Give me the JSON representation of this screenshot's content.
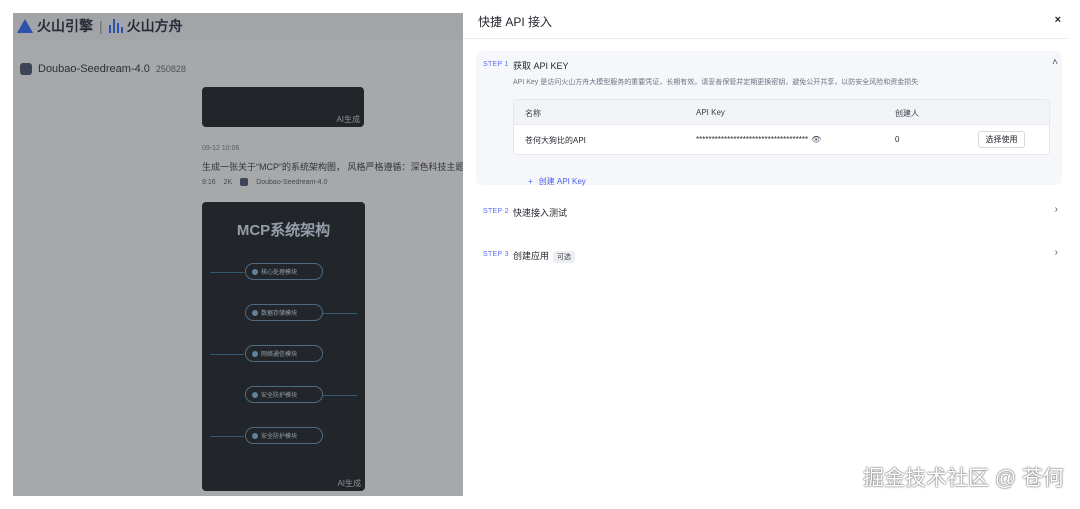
{
  "background": {
    "logo": {
      "brand1": "火山引擎",
      "separator": "|",
      "brand2": "火山方舟"
    },
    "model": {
      "name": "Doubao-Seedream-4.0",
      "version": "250828"
    },
    "top_image_tag": "AI生成",
    "history_time": "09-12 10:06",
    "prompt": "生成一张关于“MCP”的系统架构图， 风格严格遵循：深色科技主题",
    "chips": {
      "ratio": "9:16",
      "resolution": "2K",
      "model": "Doubao-Seedream-4.0"
    },
    "image": {
      "title": "MCP系统架构",
      "modules": [
        "核心处理模块",
        "数据存储模块",
        "网络通信模块",
        "安全防护模块",
        "安全防护模块"
      ],
      "tag": "AI生成"
    }
  },
  "drawer": {
    "title": "快捷 API 接入",
    "close": "×",
    "step1": {
      "label": "STEP 1",
      "name": "获取 API KEY",
      "desc": "API Key 是访问火山方舟大模型服务的重要凭证，长期有效。请妥善保管并定期更换密钥，避免公开共享，以防安全风险和资金损失",
      "columns": [
        "名称",
        "API Key",
        "创建人"
      ],
      "row": {
        "name": "苍何大狗比的API",
        "key": "************************************",
        "creator": "0",
        "action": "选择使用"
      },
      "create": "创建 API Key",
      "create_icon": "+",
      "chevron": "˄"
    },
    "step2": {
      "label": "STEP 2",
      "name": "快速接入测试",
      "chevron": "›"
    },
    "step3": {
      "label": "STEP 3",
      "name": "创建应用",
      "badge": "可选",
      "chevron": "›"
    }
  },
  "watermark": "掘金技术社区 @ 苍何"
}
